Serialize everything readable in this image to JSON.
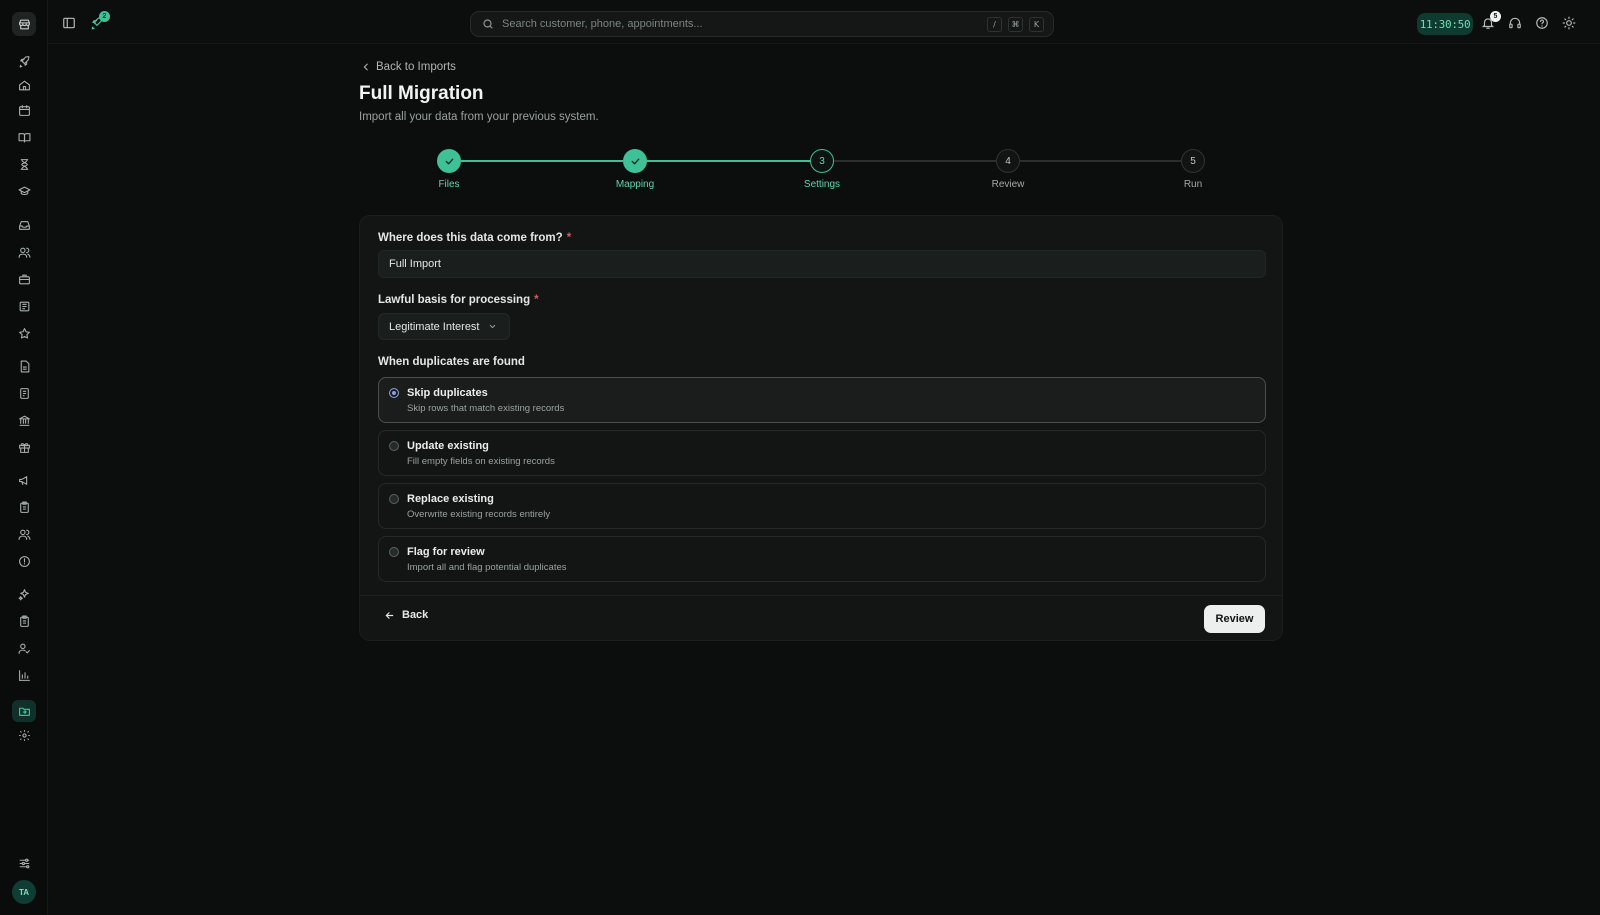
{
  "sidebar": {
    "avatar_initials": "TA",
    "icons": [
      "rocket-icon",
      "home-icon",
      "calendar-icon",
      "book-icon",
      "hourglass-icon",
      "graduation-cap-icon",
      "inbox-icon",
      "users-icon",
      "briefcase-icon",
      "newspaper-icon",
      "star-icon",
      "file-icon",
      "invoice-icon",
      "bank-icon",
      "gift-icon",
      "megaphone-icon",
      "clipboard-icon",
      "team-icon",
      "alert-circle-icon",
      "sparkles-icon",
      "checklist-icon",
      "user-check-icon",
      "bar-chart-icon",
      "folder-import-icon",
      "settings-icon",
      "sliders-icon"
    ],
    "active_icon": "folder-import-icon"
  },
  "topbar": {
    "rocket_badge": "2",
    "search_placeholder": "Search customer, phone, appointments...",
    "shortcut_keys": [
      "/",
      "⌘",
      "K"
    ],
    "clock": "11:30:50",
    "notification_count": "5"
  },
  "breadcrumb": {
    "label": "Back to Imports"
  },
  "page": {
    "title": "Full Migration",
    "subtitle": "Import all your data from your previous system."
  },
  "stepper": {
    "steps": [
      {
        "label": "Files",
        "number": "1",
        "status": "done"
      },
      {
        "label": "Mapping",
        "number": "2",
        "status": "done"
      },
      {
        "label": "Settings",
        "number": "3",
        "status": "current"
      },
      {
        "label": "Review",
        "number": "4",
        "status": "todo"
      },
      {
        "label": "Run",
        "number": "5",
        "status": "todo"
      }
    ]
  },
  "form": {
    "source_label": "Where does this data come from?",
    "source_value": "Full Import",
    "lawful_label": "Lawful basis for processing",
    "lawful_value": "Legitimate Interest",
    "required_mark": "*",
    "duplicates_label": "When duplicates are found",
    "duplicate_options": [
      {
        "title": "Skip duplicates",
        "description": "Skip rows that match existing records",
        "selected": true
      },
      {
        "title": "Update existing",
        "description": "Fill empty fields on existing records",
        "selected": false
      },
      {
        "title": "Replace existing",
        "description": "Overwrite existing records entirely",
        "selected": false
      },
      {
        "title": "Flag for review",
        "description": "Import all and flag potential duplicates",
        "selected": false
      }
    ]
  },
  "footer": {
    "back_label": "Back",
    "review_label": "Review"
  },
  "colors": {
    "accent": "#3fc197",
    "background": "#0c0d0d",
    "card": "#121514",
    "radio_selected": "#8a9bd8"
  }
}
